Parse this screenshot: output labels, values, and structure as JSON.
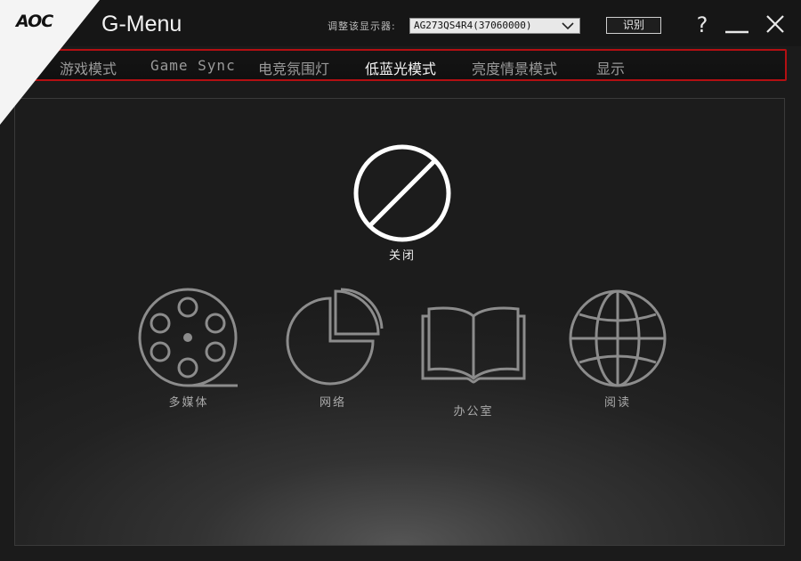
{
  "brand": "AOC",
  "app_title": "G-Menu",
  "monitor": {
    "label": "调整该显示器:",
    "selected": "AG273QS4R4(37060000)"
  },
  "identify_label": "识别",
  "help_label": "?",
  "tabs": [
    {
      "label": "游戏模式",
      "active": false
    },
    {
      "label": "Game Sync",
      "active": false
    },
    {
      "label": "电竞氛围灯",
      "active": false
    },
    {
      "label": "低蓝光模式",
      "active": true
    },
    {
      "label": "亮度情景模式",
      "active": false
    },
    {
      "label": "显示",
      "active": false
    }
  ],
  "modes": {
    "off": {
      "label": "关闭",
      "icon": "prohibited-circle-icon",
      "active": true
    },
    "multimedia": {
      "label": "多媒体",
      "icon": "film-reel-icon"
    },
    "internet": {
      "label": "网络",
      "icon": "pie-chart-icon"
    },
    "office": {
      "label": "办公室",
      "icon": "open-book-icon"
    },
    "reading": {
      "label": "阅读",
      "icon": "globe-icon"
    }
  },
  "colors": {
    "accent_red": "#b40f12",
    "background": "#1b1b1b",
    "icon_inactive": "#8c8c8c",
    "icon_active": "#ffffff"
  }
}
